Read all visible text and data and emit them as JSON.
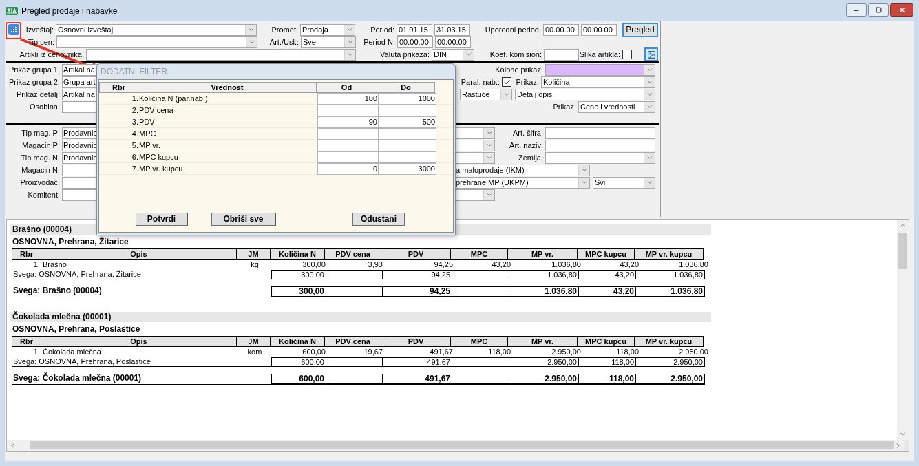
{
  "window": {
    "title": "Pregled prodaje i nabavke"
  },
  "top_rows": [
    [
      {
        "label": "Izveštaj:",
        "kind": "combo",
        "value": "Osnovni izveštaj"
      },
      {
        "label": "Promet:",
        "kind": "combo",
        "value": "Prodaja"
      },
      {
        "label": "Period:",
        "kind": "range",
        "values": [
          "01.01.15",
          "31.03.15"
        ]
      },
      {
        "label": "Uporedni period:",
        "kind": "range",
        "values": [
          "00.00.00",
          "00.00.00"
        ]
      },
      {
        "kind": "button",
        "text": "Pregled"
      }
    ],
    [
      {
        "label": "Tip cen:",
        "kind": "combo"
      },
      {
        "label": "Art./Usl.:",
        "kind": "combo",
        "value": "Sve"
      },
      {
        "label": "Period N:",
        "kind": "range",
        "values": [
          "00.00.00",
          "00.00.00"
        ]
      }
    ],
    [
      {
        "label": "Artikli iz cenovnika:",
        "kind": "combo"
      },
      {
        "label": "Valuta prikaza:",
        "kind": "combo",
        "value": "DIN"
      },
      {
        "label": "Koef. komision:",
        "kind": "text"
      },
      {
        "label": "Slika artikla:",
        "kind": "check",
        "checked": false
      },
      {
        "kind": "icon_button"
      }
    ]
  ],
  "group_section": {
    "left": [
      {
        "label": "Prikaz grupa 1:",
        "value": "Artikal na"
      },
      {
        "label": "Prikaz grupa 2:",
        "value": "Grupa art"
      },
      {
        "label": "Prikaz detalj:",
        "value": "Artikal na"
      },
      {
        "label": "Osobina:"
      }
    ],
    "right": [
      [
        {
          "label": "Kolone prikaz:",
          "kind": "combo",
          "color": "#d9b9fb"
        }
      ],
      [
        {
          "label": "Paral. nab.:",
          "kind": "check",
          "checked": true
        },
        {
          "label": "Prikaz:",
          "kind": "combo",
          "value": "Količina"
        }
      ],
      [
        {
          "kind": "combo",
          "value": "Rastuće"
        },
        {
          "kind": "combo",
          "value": "Detalj opis"
        }
      ],
      [
        {
          "label": "Prikaz:",
          "kind": "combo",
          "value": "Cene i vrednosti"
        }
      ]
    ]
  },
  "filter_section": {
    "left": [
      {
        "label": "Tip mag. P:",
        "value": "Prodavnic"
      },
      {
        "label": "Magacin P:",
        "value": "Prodavnic"
      },
      {
        "label": "Tip mag. N:",
        "value": "Prodavnic"
      },
      {
        "label": "Magacin N:"
      },
      {
        "label": "Proizvođač:"
      },
      {
        "label": "Komitent:"
      }
    ],
    "right": [
      [
        {
          "kind": "combo"
        },
        {
          "label": "Art. šifra:",
          "kind": "text"
        }
      ],
      [
        {
          "kind": "combo"
        },
        {
          "label": "Art. naziv:",
          "kind": "text"
        }
      ],
      [
        {
          "kind": "combo"
        },
        {
          "label": "Zemlja:",
          "kind": "combo"
        }
      ],
      [
        {
          "kind": "combo",
          "value": "a maloprodaje (IKM)"
        }
      ],
      [
        {
          "kind": "combo",
          "value": "prehrane MP (UKPM)"
        },
        {
          "kind": "combo",
          "value": "Svi"
        }
      ],
      [
        {
          "kind": "combo"
        }
      ]
    ]
  },
  "dialog": {
    "title": "DODATNI FILTER",
    "columns": [
      "Rbr",
      "Vrednost",
      "Od",
      "Do"
    ],
    "rows": [
      {
        "rbr": "1.",
        "name": "Količina N (par.nab.)",
        "od": "100",
        "do": "1000"
      },
      {
        "rbr": "2.",
        "name": "PDV cena"
      },
      {
        "rbr": "3.",
        "name": "PDV",
        "od": "90",
        "do": "500"
      },
      {
        "rbr": "4.",
        "name": "MPC"
      },
      {
        "rbr": "5.",
        "name": "MP vr."
      },
      {
        "rbr": "6.",
        "name": "MPC kupcu"
      },
      {
        "rbr": "7.",
        "name": "MP vr. kupcu",
        "od": "0",
        "do": "3000"
      }
    ],
    "buttons": [
      "Potvrdi",
      "Obriši sve",
      "Odustani"
    ]
  },
  "report": {
    "groups": [
      {
        "title": "Brašno (00004)",
        "category": "OSNOVNA, Prehrana, Žitarice",
        "columns": [
          "Rbr",
          "Opis",
          "JM",
          "Količina N",
          "PDV cena",
          "PDV",
          "MPC",
          "MP vr.",
          "MPC kupcu",
          "MP vr. kupcu"
        ],
        "rows": [
          {
            "rbr": "1.",
            "opis": "Brašno",
            "jm": "kg",
            "values": [
              "300,00",
              "3,93",
              "94,25",
              "43,20",
              "1.036,80",
              "43,20",
              "1.036,80"
            ]
          }
        ],
        "subtotal": {
          "label": "Svega: OSNOVNA, Prehrana, Žitarice",
          "kolicina_n": "300,00",
          "pdv": "94,25",
          "mp_vr": "1.036,80",
          "mpc_kupcu": "43,20",
          "mp_vr_kupcu": "1.036,80"
        },
        "total": {
          "label": "Svega: Brašno (00004)",
          "kolicina_n": "300,00",
          "pdv": "94,25",
          "mp_vr": "1.036,80",
          "mpc_kupcu": "43,20",
          "mp_vr_kupcu": "1.036,80"
        }
      },
      {
        "title": "Čokolada mlečna (00001)",
        "category": "OSNOVNA, Prehrana, Poslastice",
        "columns": [
          "Rbr",
          "Opis",
          "JM",
          "Količina N",
          "PDV cena",
          "PDV",
          "MPC",
          "MP vr.",
          "MPC kupcu",
          "MP vr. kupcu"
        ],
        "rows": [
          {
            "rbr": "1.",
            "opis": "Čokolada mlečna",
            "jm": "kom",
            "values": [
              "600,00",
              "19,67",
              "491,67",
              "118,00",
              "2.950,00",
              "118,00",
              "2.950,00"
            ]
          }
        ],
        "subtotal": {
          "label": "Svega: OSNOVNA, Prehrana, Poslastice",
          "kolicina_n": "600,00",
          "pdv": "491,67",
          "mp_vr": "2.950,00",
          "mpc_kupcu": "118,00",
          "mp_vr_kupcu": "2.950,00"
        },
        "total": {
          "label": "Svega: Čokolada mlečna (00001)",
          "kolicina_n": "600,00",
          "pdv": "491,67",
          "mp_vr": "2.950,00",
          "mpc_kupcu": "118,00",
          "mp_vr_kupcu": "2.950,00"
        }
      }
    ]
  }
}
